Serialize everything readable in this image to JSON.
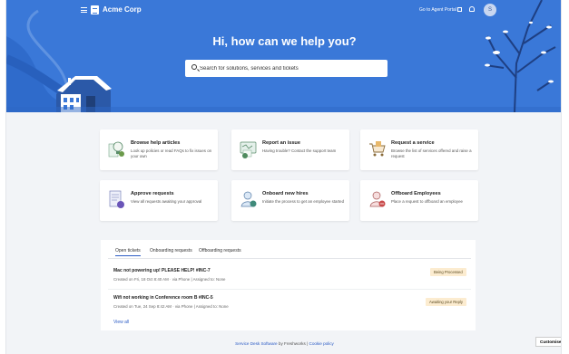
{
  "header": {
    "brand": "Acme Corp",
    "portal_link": "Go to Agent Portal",
    "avatar_initial": "S"
  },
  "hero": {
    "title": "Hi, how can we help you?",
    "search_placeholder": "Search for solutions, services and tickets"
  },
  "cards": [
    {
      "title": "Browse help articles",
      "desc": "Look up policies or read FAQs to fix issues on your own",
      "icon": "bulb-icon"
    },
    {
      "title": "Report an issue",
      "desc": "Having trouble? Contact the support team",
      "icon": "report-icon"
    },
    {
      "title": "Request a service",
      "desc": "Browse the list of services offered and raise a request",
      "icon": "cart-icon"
    },
    {
      "title": "Approve requests",
      "desc": "View all requests awaiting your approval",
      "icon": "approve-icon"
    },
    {
      "title": "Onboard new hires",
      "desc": "Initiate the process to get an employee started",
      "icon": "onboard-icon"
    },
    {
      "title": "Offboard Employees",
      "desc": "Place a request to offboard an employee",
      "icon": "offboard-icon"
    }
  ],
  "tickets": {
    "tabs": [
      "Open tickets",
      "Onboarding requests",
      "Offboarding requests"
    ],
    "items": [
      {
        "title": "Mac not powering up! PLEASE HELP! #INC-7",
        "created": "Created on Fri, 18 Oct 8:40 AM",
        "via": "via Phone",
        "assigned": "Assigned to: None",
        "status": "Being Processed"
      },
      {
        "title": "Wifi not working in Conference room B #INC-5",
        "created": "Created on Tue, 24 Sep 8:42 AM",
        "via": "via Phone",
        "assigned": "Assigned to: None",
        "status": "Awaiting your Reply"
      }
    ],
    "view_all": "View all"
  },
  "footer": {
    "software": "Service Desk Software",
    "by": "by Freshworks",
    "sep": "|",
    "cookie": "Cookie policy"
  },
  "customise": "Customise",
  "colors": {
    "hero": "#3a78d8",
    "accent": "#2c5cc5",
    "status_bg": "#fcecd0"
  }
}
